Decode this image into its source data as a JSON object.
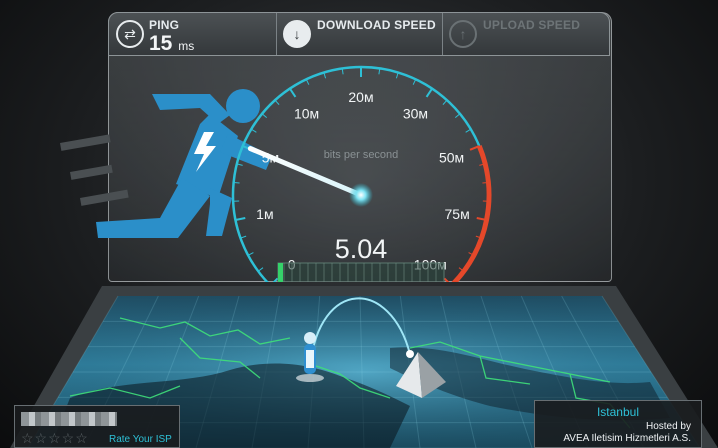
{
  "ping": {
    "label": "PING",
    "value": "15",
    "unit": "ms"
  },
  "download": {
    "label": "DOWNLOAD SPEED"
  },
  "upload": {
    "label": "UPLOAD SPEED"
  },
  "gauge": {
    "unit_text": "bits per second",
    "current_value": "5.04",
    "ticks": [
      "0",
      "1м",
      "5м",
      "10м",
      "20м",
      "30м",
      "50м",
      "75м",
      "100м"
    ],
    "needle_value_mbps": 5.04
  },
  "rating": {
    "link_text": "Rate Your ISP",
    "stars": "☆☆☆☆☆"
  },
  "server": {
    "city": "Istanbul",
    "hosted_by": "Hosted by",
    "host": "AVEA Iletisim Hizmetleri A.S."
  },
  "colors": {
    "accent": "#2ec0d6",
    "danger": "#e5482a",
    "runner": "#2b8fc9"
  }
}
